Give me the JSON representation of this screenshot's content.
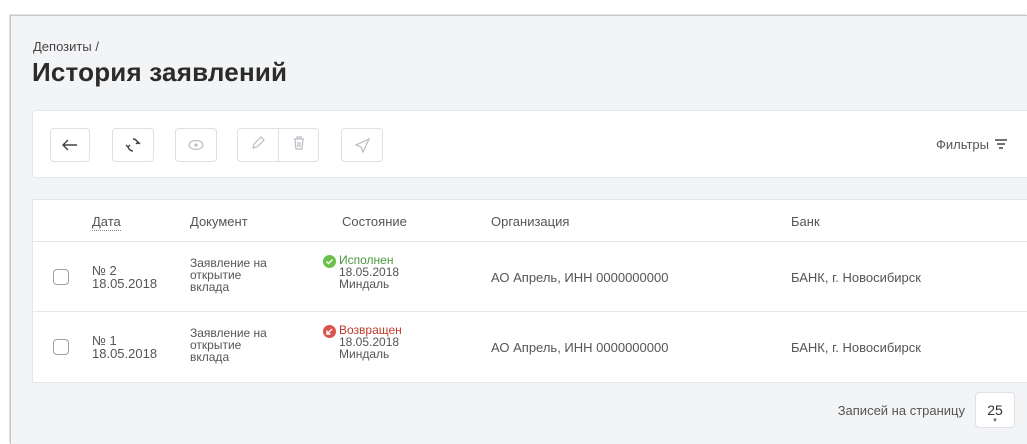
{
  "breadcrumb": {
    "parent": "Депозиты",
    "separator": "/"
  },
  "page_title": "История заявлений",
  "toolbar": {
    "back_icon": "arrow-left-icon",
    "refresh_icon": "refresh-icon",
    "view_icon": "eye-icon",
    "edit_icon": "pencil-icon",
    "delete_icon": "trash-icon",
    "send_icon": "send-icon",
    "filters_label": "Фильтры",
    "filters_icon": "filter-icon"
  },
  "table": {
    "columns": [
      "Дата",
      "Документ",
      "Состояние",
      "Организация",
      "Банк"
    ],
    "rows": [
      {
        "number": "№ 2",
        "date": "18.05.2018",
        "document": [
          "Заявление на",
          "открытие",
          "вклада"
        ],
        "status_label": "Исполнен",
        "status_date": "18.05.2018",
        "status_user": "Миндаль",
        "status_kind": "success",
        "organization": "АО Апрель, ИНН 0000000000",
        "bank": "БАНК, г. Новосибирск"
      },
      {
        "number": "№ 1",
        "date": "18.05.2018",
        "document": [
          "Заявление на",
          "открытие",
          "вклада"
        ],
        "status_label": "Возвращен",
        "status_date": "18.05.2018",
        "status_user": "Миндаль",
        "status_kind": "returned",
        "organization": "АО Апрель, ИНН 0000000000",
        "bank": "БАНК, г. Новосибирск"
      }
    ]
  },
  "pagination": {
    "label": "Записей на страницу",
    "per_page": "25"
  },
  "colors": {
    "success": "#6cc04a",
    "returned": "#d9534f",
    "background": "#f3f4f6"
  }
}
